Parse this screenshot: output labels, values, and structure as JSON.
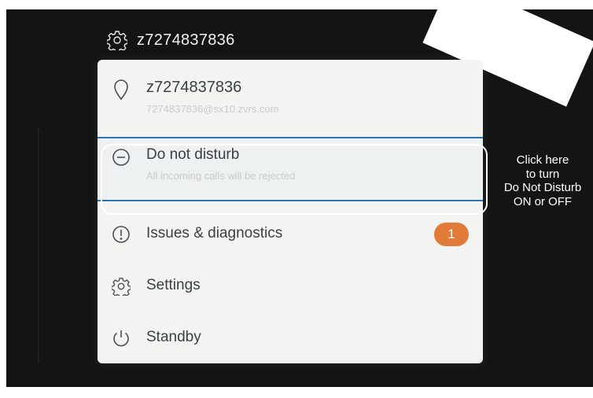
{
  "header": {
    "settings_icon": "gear-icon",
    "title": "z7274837836"
  },
  "menu": {
    "user": {
      "icon": "location-pin-icon",
      "name": "z7274837836",
      "address": "7274837836@sx10.zvrs.com"
    },
    "do_not_disturb": {
      "icon": "minus-circle-icon",
      "label": "Do not disturb",
      "description": "All incoming calls will be rejected",
      "highlight_color": "#2b74b5"
    },
    "issues": {
      "icon": "exclamation-circle-icon",
      "label": "Issues & diagnostics",
      "badge": "1",
      "badge_color": "#e07b39"
    },
    "settings": {
      "icon": "gear-icon",
      "label": "Settings"
    },
    "standby": {
      "icon": "power-icon",
      "label": "Standby"
    }
  },
  "annotation": {
    "lines": [
      "Click here",
      "to turn",
      "Do Not Disturb",
      "ON or OFF"
    ]
  }
}
